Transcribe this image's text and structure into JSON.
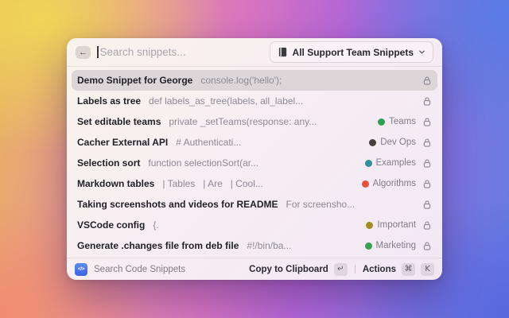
{
  "search": {
    "back_label": "←",
    "placeholder": "Search snippets..."
  },
  "dropdown": {
    "label": "All Support Team Snippets"
  },
  "rows": [
    {
      "title": "Demo Snippet for George",
      "subtitle": "console.log('hello');",
      "tag": null,
      "selected": true,
      "locked": true
    },
    {
      "title": "Labels as tree",
      "subtitle": "def labels_as_tree(labels, all_label...",
      "tag": null,
      "selected": false,
      "locked": true
    },
    {
      "title": "Set editable teams",
      "subtitle": "private _setTeams(response: any...",
      "tag": {
        "label": "Teams",
        "color": "#2fa156"
      },
      "selected": false,
      "locked": true
    },
    {
      "title": "Cacher External API",
      "subtitle": "# Authenticati...",
      "tag": {
        "label": "Dev Ops",
        "color": "#44403a"
      },
      "selected": false,
      "locked": true
    },
    {
      "title": "Selection sort",
      "subtitle": "function selectionSort(ar...",
      "tag": {
        "label": "Examples",
        "color": "#2f9095"
      },
      "selected": false,
      "locked": true
    },
    {
      "title": "Markdown tables",
      "subtitle": "| Tables   | Are   | Cool...",
      "tag": {
        "label": "Algorithms",
        "color": "#e8503a"
      },
      "selected": false,
      "locked": true
    },
    {
      "title": "Taking screenshots and videos for README",
      "subtitle": "For screensho...",
      "tag": null,
      "selected": false,
      "locked": true
    },
    {
      "title": "VSCode config",
      "subtitle": "{.",
      "tag": {
        "label": "Important",
        "color": "#a38d21"
      },
      "selected": false,
      "locked": true
    },
    {
      "title": "Generate .changes file from deb file",
      "subtitle": "#!/bin/ba...",
      "tag": {
        "label": "Marketing",
        "color": "#38a156"
      },
      "selected": false,
      "locked": true
    }
  ],
  "statusbar": {
    "app_icon": "</>",
    "app_label": "Search Code Snippets",
    "primary_action": "Copy to Clipboard",
    "primary_key": "↵",
    "secondary_action": "Actions",
    "secondary_keys": [
      "⌘",
      "K"
    ]
  },
  "colors": {
    "selected_row_bg": "#ddd6d9",
    "extension_icon_blue": "#4a7de8"
  }
}
